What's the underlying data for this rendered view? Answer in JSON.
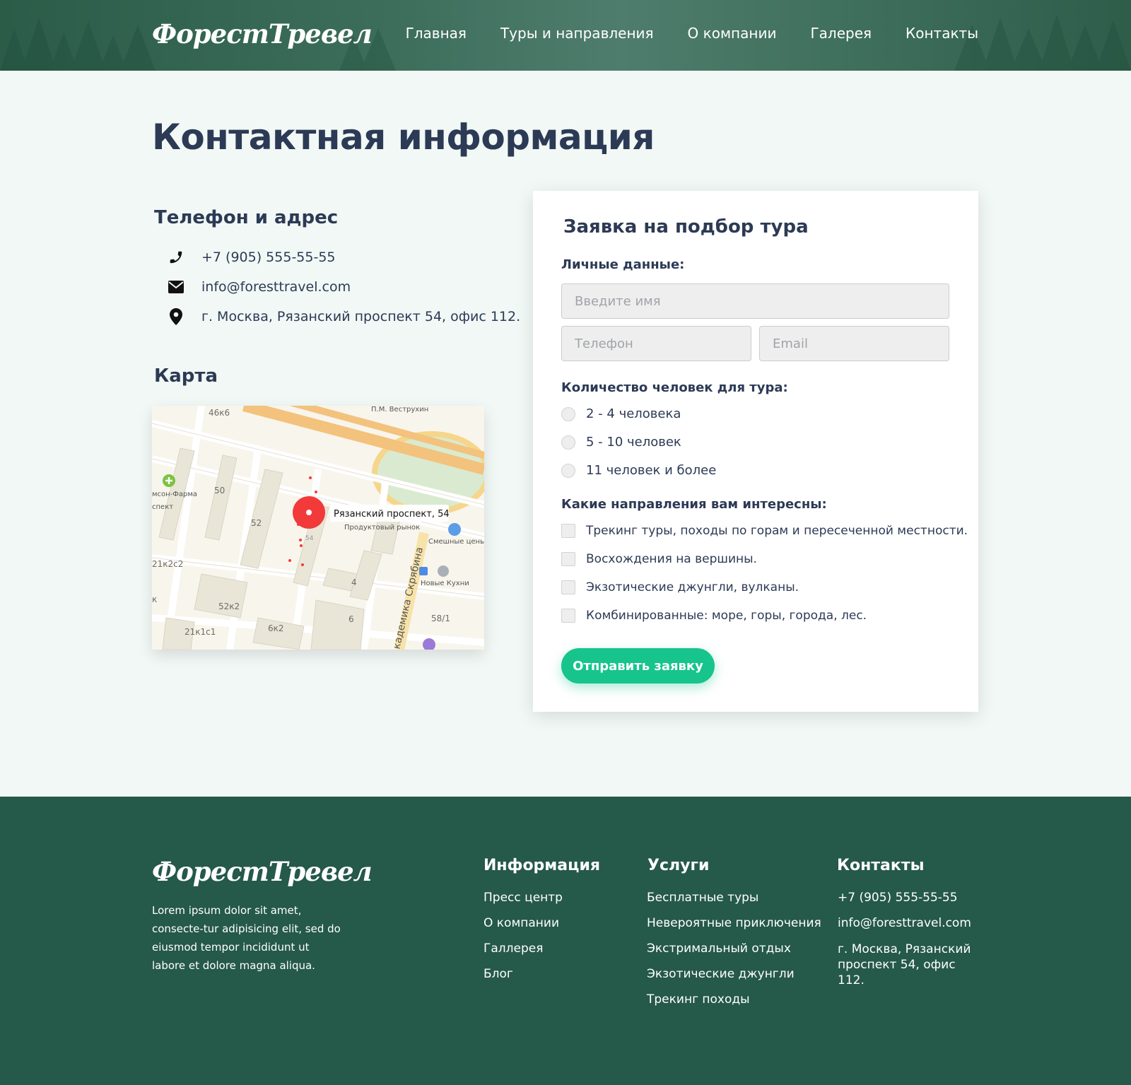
{
  "header": {
    "logo": "ФорестТревел",
    "nav": [
      "Главная",
      "Туры и направления",
      "О компании",
      "Галерея",
      "Контакты"
    ]
  },
  "main": {
    "title": "Контактная информация",
    "phone_section_title": "Телефон и адрес",
    "phone": "+7 (905) 555-55-55",
    "email": "info@foresttravel.com",
    "address": "г. Москва, Рязанский проспект 54, офис 112.",
    "map_section_title": "Карта",
    "map": {
      "marker_label": "Рязанский проспект, 54",
      "labels": [
        "46к6",
        "П.М. Веструхин",
        "мсон-Фарма",
        "спект",
        "50",
        "52",
        "Продуктовый рынок",
        "Смешные цены",
        "21к2с2",
        "4",
        "Новые Кухни",
        "52к2",
        "6",
        "58/1",
        "21к1с1",
        "6к2",
        "кадемика Скрябина",
        "к",
        "54"
      ]
    }
  },
  "form": {
    "title": "Заявка на подбор тура",
    "personal_label": "Личные данные:",
    "name_placeholder": "Введите имя",
    "phone_placeholder": "Телефон",
    "email_placeholder": "Email",
    "people_label": "Количество человек для тура:",
    "people_options": [
      "2 - 4 человека",
      "5 - 10 человек",
      "11 человек и более"
    ],
    "directions_label": "Какие направления вам интересны:",
    "directions": [
      "Трекинг туры, походы по горам и пересеченной местности.",
      "Восхождения на вершины.",
      "Экзотические джунгли, вулканы.",
      "Комбинированные: море, горы, города, лес."
    ],
    "submit_label": "Отправить заявку"
  },
  "footer": {
    "logo": "ФорестТревел",
    "about": "Lorem ipsum dolor sit amet, consecte-tur adipisicing elit, sed do eiusmod tempor incididunt ut labore et dolore magna aliqua.",
    "info_title": "Информация",
    "info_links": [
      "Пресс центр",
      "О компании",
      "Галлерея",
      "Блог"
    ],
    "services_title": "Услуги",
    "services_links": [
      "Бесплатные туры",
      "Невероятные приключения",
      "Экстримальный отдых",
      "Экзотические джунгли",
      "Трекинг походы"
    ],
    "contacts_title": "Контакты",
    "phone": "+7 (905) 555-55-55",
    "email": "info@foresttravel.com",
    "address": "г. Москва, Рязанский проспект 54, офис 112."
  },
  "colors": {
    "accent": "#17c48c",
    "footer_bg": "#25594a",
    "heading": "#2c3a55",
    "page_bg": "#f1f8f5",
    "map_marker": "#f23a3a"
  },
  "icons": [
    "phone-icon",
    "envelope-icon",
    "location-pin-icon"
  ]
}
